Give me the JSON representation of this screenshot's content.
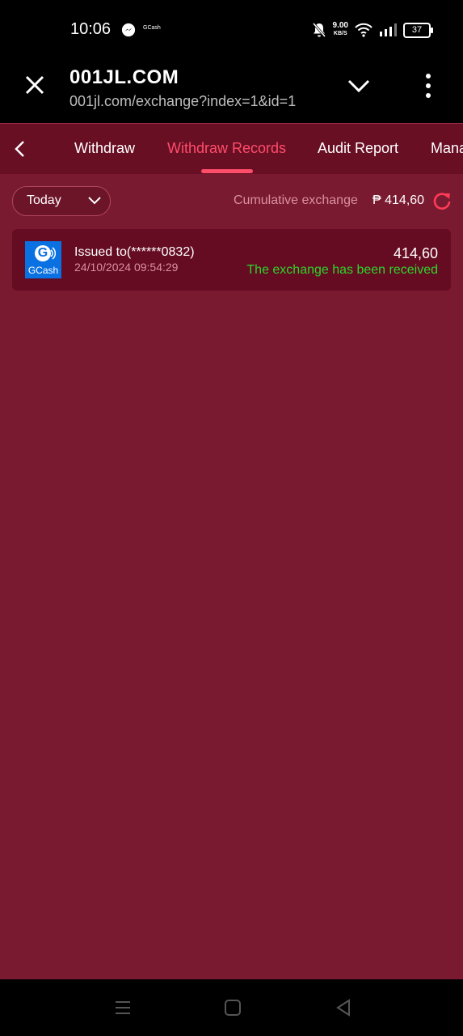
{
  "status_bar": {
    "time": "10:06",
    "notification_app": "GCash",
    "net_speed": "9.00",
    "net_speed_unit": "KB/S",
    "battery": "37"
  },
  "browser": {
    "title": "001JL.COM",
    "url": "001jl.com/exchange?index=1&id=1"
  },
  "tabs": [
    {
      "label": "Withdraw",
      "active": false
    },
    {
      "label": "Withdraw Records",
      "active": true
    },
    {
      "label": "Audit Report",
      "active": false
    },
    {
      "label": "Mana",
      "active": false
    }
  ],
  "filter": {
    "selected": "Today"
  },
  "summary": {
    "label": "Cumulative exchange",
    "value": "₱ 414,60"
  },
  "records": [
    {
      "method": "GCash",
      "title": "Issued to(******0832)",
      "datetime": "24/10/2024 09:54:29",
      "amount": "414,60",
      "status": "The exchange has been received"
    }
  ],
  "colors": {
    "page_bg": "#7a1a30",
    "tabbar_bg": "#690f24",
    "accent": "#ff4d6a",
    "success": "#2bd62b",
    "gcash_blue": "#0a71e3"
  },
  "icons": [
    "messenger-icon",
    "bell-off-icon",
    "wifi-icon",
    "signal-icon",
    "battery-icon",
    "close-icon",
    "chevron-down-icon",
    "more-vertical-icon",
    "chevron-left-icon",
    "refresh-icon",
    "menu-icon",
    "home-icon",
    "back-icon"
  ]
}
